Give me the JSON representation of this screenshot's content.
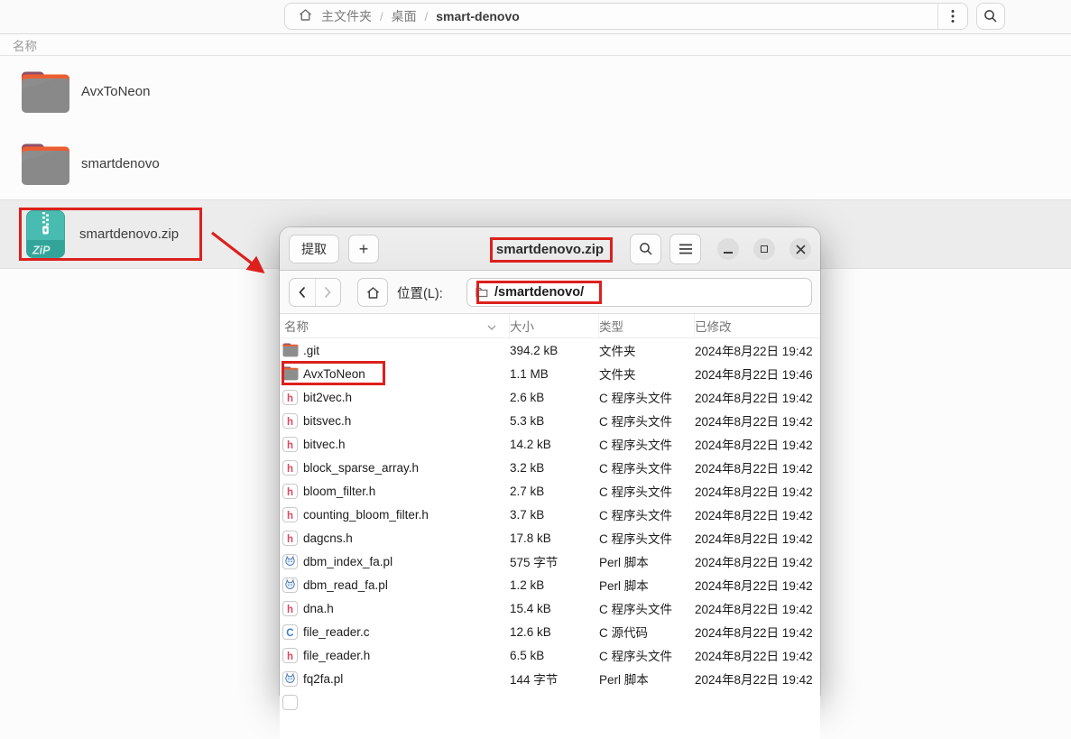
{
  "nautilus": {
    "breadcrumb": {
      "home": "主文件夹",
      "sep1": "/",
      "desktop": "桌面",
      "sep2": "/",
      "current": "smart-denovo"
    },
    "list_header": "名称",
    "items": [
      {
        "label": "AvxToNeon",
        "icon": "folder",
        "selected": false
      },
      {
        "label": "smartdenovo",
        "icon": "folder",
        "selected": false
      },
      {
        "label": "smartdenovo.zip",
        "icon": "zip",
        "selected": true
      }
    ]
  },
  "archive": {
    "extract_label": "提取",
    "add_label": "+",
    "title": "smartdenovo.zip",
    "location_label": "位置(L):",
    "location_value": "/smartdenovo/",
    "columns": {
      "name": "名称",
      "size": "大小",
      "type": "类型",
      "modified": "已修改"
    },
    "rows": [
      {
        "name": ".git",
        "size": "394.2 kB",
        "type": "文件夹",
        "modified": "2024年8月22日 19:42",
        "icon": "folder"
      },
      {
        "name": "AvxToNeon",
        "size": "1.1 MB",
        "type": "文件夹",
        "modified": "2024年8月22日 19:46",
        "icon": "folder",
        "highlight": true
      },
      {
        "name": "bit2vec.h",
        "size": "2.6 kB",
        "type": "C 程序头文件",
        "modified": "2024年8月22日 19:42",
        "icon": "h"
      },
      {
        "name": "bitsvec.h",
        "size": "5.3 kB",
        "type": "C 程序头文件",
        "modified": "2024年8月22日 19:42",
        "icon": "h"
      },
      {
        "name": "bitvec.h",
        "size": "14.2 kB",
        "type": "C 程序头文件",
        "modified": "2024年8月22日 19:42",
        "icon": "h"
      },
      {
        "name": "block_sparse_array.h",
        "size": "3.2 kB",
        "type": "C 程序头文件",
        "modified": "2024年8月22日 19:42",
        "icon": "h"
      },
      {
        "name": "bloom_filter.h",
        "size": "2.7 kB",
        "type": "C 程序头文件",
        "modified": "2024年8月22日 19:42",
        "icon": "h"
      },
      {
        "name": "counting_bloom_filter.h",
        "size": "3.7 kB",
        "type": "C 程序头文件",
        "modified": "2024年8月22日 19:42",
        "icon": "h"
      },
      {
        "name": "dagcns.h",
        "size": "17.8 kB",
        "type": "C 程序头文件",
        "modified": "2024年8月22日 19:42",
        "icon": "h"
      },
      {
        "name": "dbm_index_fa.pl",
        "size": "575 字节",
        "type": "Perl 脚本",
        "modified": "2024年8月22日 19:42",
        "icon": "perl"
      },
      {
        "name": "dbm_read_fa.pl",
        "size": "1.2 kB",
        "type": "Perl 脚本",
        "modified": "2024年8月22日 19:42",
        "icon": "perl"
      },
      {
        "name": "dna.h",
        "size": "15.4 kB",
        "type": "C 程序头文件",
        "modified": "2024年8月22日 19:42",
        "icon": "h"
      },
      {
        "name": "file_reader.c",
        "size": "12.6 kB",
        "type": "C 源代码",
        "modified": "2024年8月22日 19:42",
        "icon": "c"
      },
      {
        "name": "file_reader.h",
        "size": "6.5 kB",
        "type": "C 程序头文件",
        "modified": "2024年8月22日 19:42",
        "icon": "h"
      },
      {
        "name": "fq2fa.pl",
        "size": "144 字节",
        "type": "Perl 脚本",
        "modified": "2024年8月22日 19:42",
        "icon": "perl"
      },
      {
        "name": "",
        "size": "",
        "type": "",
        "modified": "",
        "icon": "blank"
      }
    ]
  },
  "icons": {
    "home": "house-outline",
    "search": "magnifier",
    "kebab": "three-dots-vertical",
    "hamburger": "three-lines",
    "minimize": "dash",
    "maximize": "square-outline",
    "close": "cross",
    "back": "chevron-left",
    "forward": "chevron-right",
    "sort": "chevron-down",
    "location_folder": "folder-outline",
    "zip_badge_text": "ZiP"
  },
  "annotation_colors": {
    "highlight_red": "#dc201d"
  }
}
